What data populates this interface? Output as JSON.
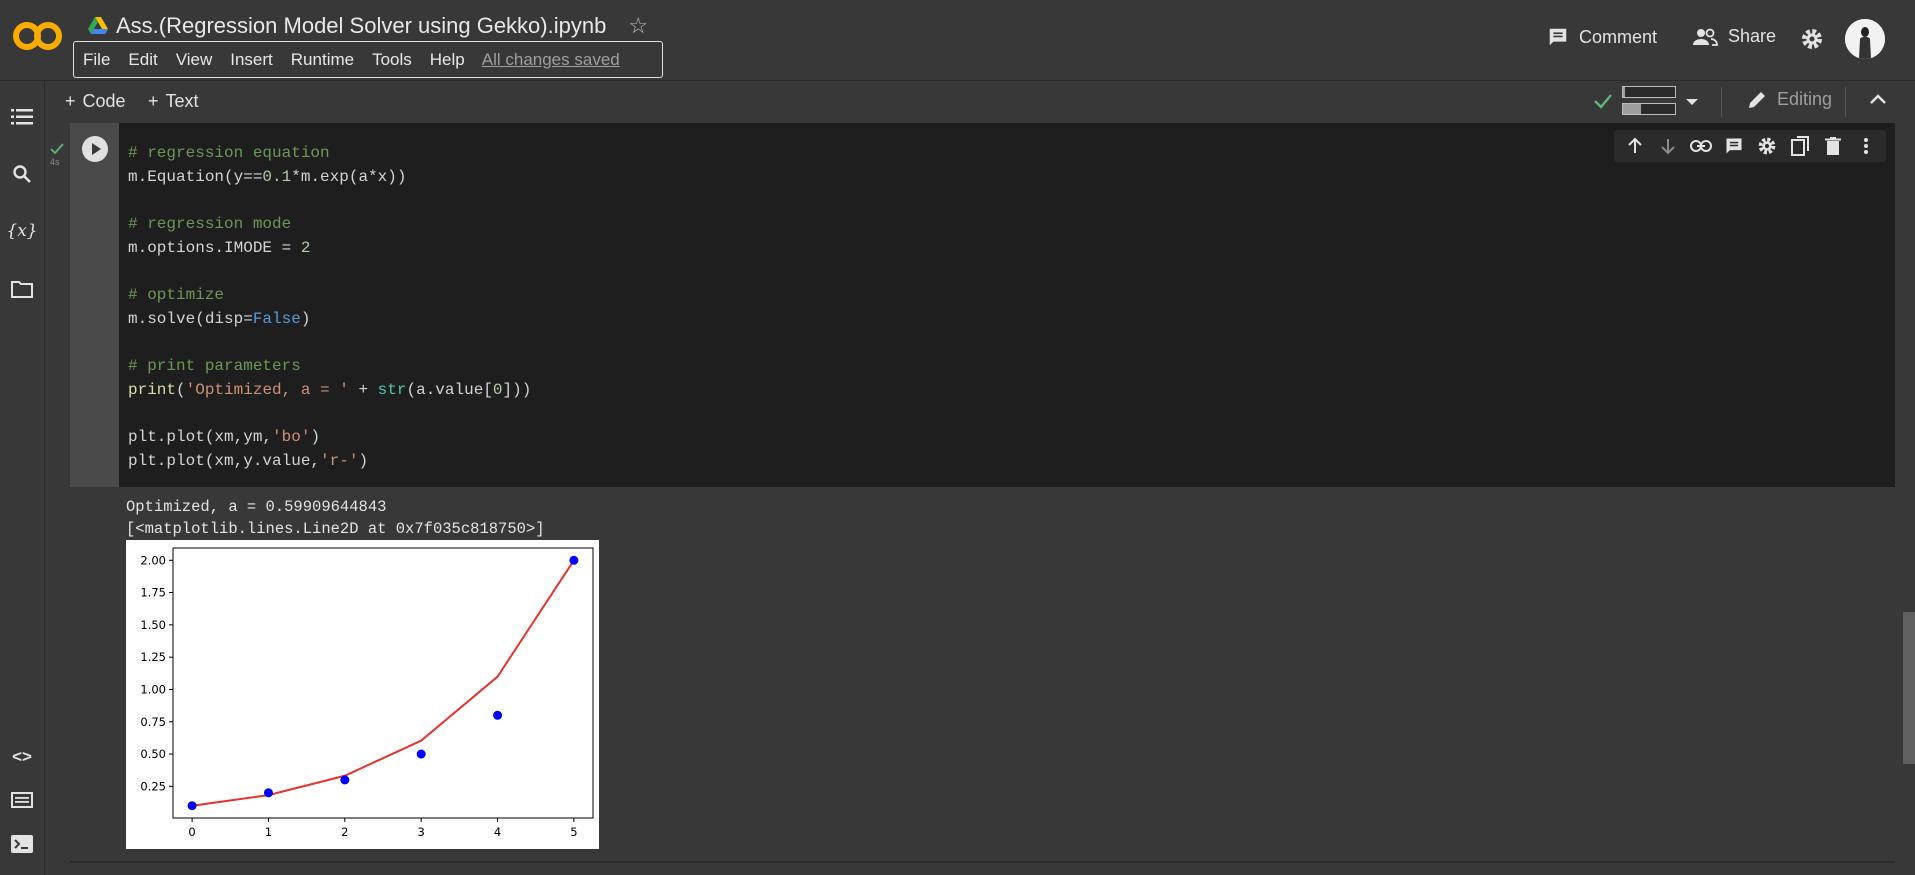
{
  "header": {
    "notebook_title": "Ass.(Regression Model Solver using Gekko).ipynb",
    "menu": [
      "File",
      "Edit",
      "View",
      "Insert",
      "Runtime",
      "Tools",
      "Help"
    ],
    "save_status": "All changes saved",
    "comment_label": "Comment",
    "share_label": "Share"
  },
  "toolbar": {
    "add_code_label": "Code",
    "add_text_label": "Text",
    "ram_label": "RAM",
    "disk_label": "Disk",
    "ram_usage": 0.04,
    "disk_usage": 0.35,
    "editing_label": "Editing"
  },
  "cell": {
    "exec_time": "4s",
    "output_lines": [
      "Optimized, a = 0.59909644843",
      "[<matplotlib.lines.Line2D at 0x7f035c818750>]"
    ]
  },
  "colors": {
    "logo_orange": "#f9ab00",
    "data_points": "#0000ff",
    "fit_line": "#e8322d"
  },
  "chart_data": {
    "type": "line",
    "title": "",
    "xlabel": "",
    "ylabel": "",
    "xlim": [
      -0.25,
      5.25
    ],
    "ylim": [
      0.1,
      2.0
    ],
    "x_ticks": [
      "0",
      "1",
      "2",
      "3",
      "4",
      "5"
    ],
    "y_ticks": [
      "0.25",
      "0.50",
      "0.75",
      "1.00",
      "1.25",
      "1.50",
      "1.75",
      "2.00"
    ],
    "series": [
      {
        "style": "bo",
        "x": [
          0,
          1,
          2,
          3,
          4,
          5
        ],
        "y": [
          0.1,
          0.2,
          0.3,
          0.5,
          0.8,
          2.0
        ]
      },
      {
        "style": "r-",
        "x": [
          0,
          1,
          2,
          3,
          4,
          5
        ],
        "y": [
          0.1,
          0.182,
          0.332,
          0.604,
          1.099,
          2.0
        ]
      }
    ],
    "grid": false
  }
}
